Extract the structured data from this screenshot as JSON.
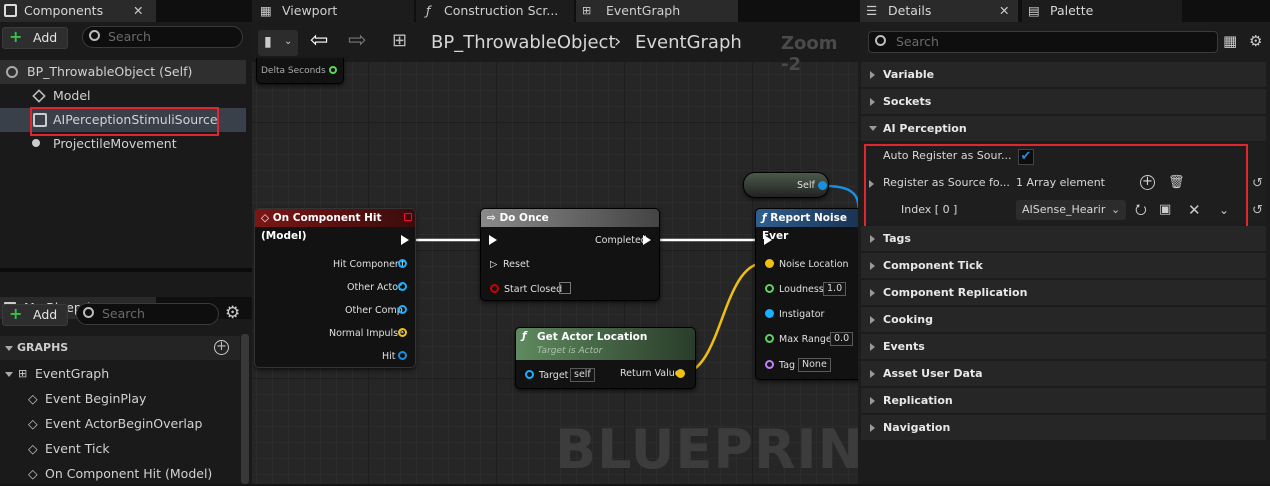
{
  "components": {
    "tab_label": "Components",
    "add_label": "Add",
    "search_placeholder": "Search",
    "tree": [
      {
        "label": "BP_ThrowableObject (Self)"
      },
      {
        "label": "Model"
      },
      {
        "label": "AIPerceptionStimuliSource"
      },
      {
        "label": "ProjectileMovement"
      }
    ]
  },
  "my_blueprint": {
    "tab_label": "My Blueprint",
    "add_label": "Add",
    "search_placeholder": "Search",
    "graphs_label": "GRAPHS",
    "event_graph_label": "EventGraph",
    "events": [
      "Event BeginPlay",
      "Event ActorBeginOverlap",
      "Event Tick",
      "On Component Hit (Model)"
    ]
  },
  "editor_tabs": [
    "Viewport",
    "Construction Scr...",
    "EventGraph"
  ],
  "graph": {
    "breadcrumb_blueprint": "BP_ThrowableObject",
    "breadcrumb_graph": "EventGraph",
    "zoom": "Zoom -2",
    "watermark": "BLUEPRINT",
    "delta_seconds": "Delta Seconds",
    "hit_node": {
      "title": "On Component Hit (Model)",
      "pins": [
        "Hit Component",
        "Other Actor",
        "Other Comp",
        "Normal Impulse",
        "Hit"
      ]
    },
    "do_once": {
      "title": "Do Once",
      "completed": "Completed",
      "reset": "Reset",
      "start_closed": "Start Closed"
    },
    "self_node": {
      "label": "Self"
    },
    "report_noise": {
      "title": "Report Noise Ever",
      "noise_location": "Noise Location",
      "loudness": "Loudness",
      "loudness_value": "1.0",
      "instigator": "Instigator",
      "max_range": "Max Range",
      "max_range_value": "0.0",
      "tag": "Tag",
      "tag_value": "None"
    },
    "get_actor_location": {
      "title": "Get Actor Location",
      "subtitle": "Target is Actor",
      "target": "Target",
      "target_value": "self",
      "return_value": "Return Value"
    }
  },
  "details": {
    "tab_label": "Details",
    "palette_label": "Palette",
    "search_placeholder": "Search",
    "categories_top": [
      "Variable",
      "Sockets"
    ],
    "ai_perception_label": "AI Perception",
    "auto_register_label": "Auto Register as Sour...",
    "auto_register_checked": true,
    "register_source_label": "Register as Source fo...",
    "register_source_value": "1 Array element",
    "index_label": "Index [ 0 ]",
    "index_value": "AISense_Hearir",
    "categories_bottom": [
      "Tags",
      "Component Tick",
      "Component Replication",
      "Cooking",
      "Events",
      "Asset User Data",
      "Replication",
      "Navigation"
    ]
  },
  "colors": {
    "highlight": "#e0262e",
    "selection": "#2b4a6e",
    "accent": "#1a8fe0"
  }
}
